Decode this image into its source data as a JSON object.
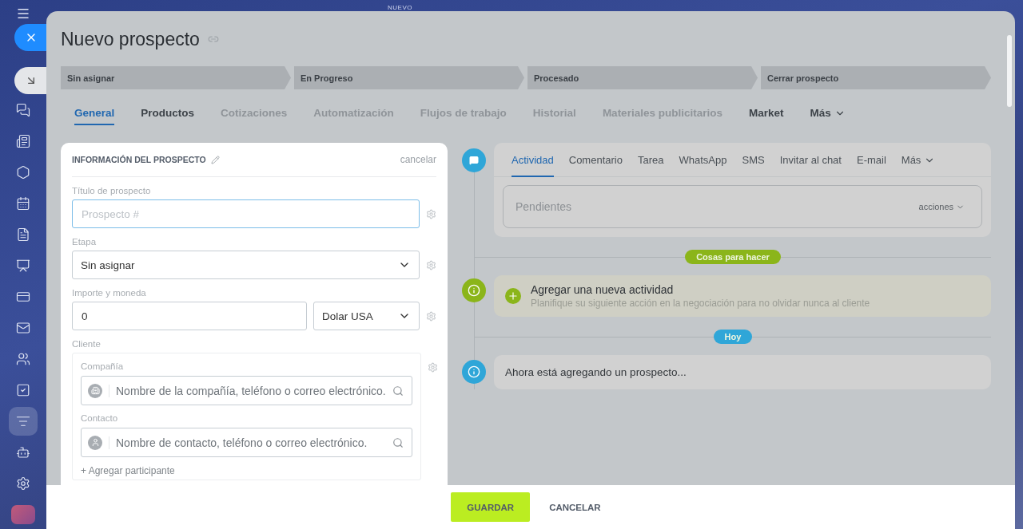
{
  "background_label": "NUEVO",
  "title": "Nuevo prospecto",
  "stages": [
    {
      "label": "Sin asignar"
    },
    {
      "label": "En Progreso"
    },
    {
      "label": "Procesado"
    },
    {
      "label": "Cerrar prospecto"
    }
  ],
  "tabs": [
    {
      "label": "General",
      "selected": true,
      "disabled": false
    },
    {
      "label": "Productos",
      "selected": false,
      "disabled": false
    },
    {
      "label": "Cotizaciones",
      "selected": false,
      "disabled": true
    },
    {
      "label": "Automatización",
      "selected": false,
      "disabled": true
    },
    {
      "label": "Flujos de trabajo",
      "selected": false,
      "disabled": true
    },
    {
      "label": "Historial",
      "selected": false,
      "disabled": true
    },
    {
      "label": "Materiales publicitarios",
      "selected": false,
      "disabled": true
    },
    {
      "label": "Market",
      "selected": false,
      "disabled": false
    },
    {
      "label": "Más",
      "selected": false,
      "disabled": false,
      "dropdown": true
    }
  ],
  "info_card": {
    "title": "INFORMACIÓN DEL PROSPECTO",
    "cancel": "cancelar",
    "title_field": {
      "label": "Título de prospecto",
      "placeholder": "Prospecto #"
    },
    "stage_field": {
      "label": "Etapa",
      "value": "Sin asignar"
    },
    "amount_field": {
      "label": "Importe y moneda",
      "value": "0",
      "currency": "Dolar USA"
    },
    "client": {
      "label": "Cliente",
      "company": {
        "label": "Compañía",
        "placeholder": "Nombre de la compañía, teléfono o correo electrónico."
      },
      "contact": {
        "label": "Contacto",
        "placeholder": "Nombre de contacto, teléfono o correo electrónico."
      },
      "add": "+ Agregar participante"
    }
  },
  "activity_tabs": [
    {
      "label": "Actividad",
      "selected": true
    },
    {
      "label": "Comentario",
      "selected": false
    },
    {
      "label": "Tarea",
      "selected": false
    },
    {
      "label": "WhatsApp",
      "selected": false
    },
    {
      "label": "SMS",
      "selected": false
    },
    {
      "label": "Invitar al chat",
      "selected": false
    },
    {
      "label": "E-mail",
      "selected": false
    },
    {
      "label": "Más",
      "selected": false,
      "dropdown": true
    }
  ],
  "pending": {
    "placeholder": "Pendientes",
    "actions": "acciones"
  },
  "todo_badge": "Cosas para hacer",
  "new_activity": {
    "title": "Agregar una nueva actividad",
    "subtitle": "Planifique su siguiente acción en la negociación para no olvidar nunca al cliente"
  },
  "today_badge": "Hoy",
  "event": "Ahora está agregando un prospecto...",
  "buttons": {
    "save": "GUARDAR",
    "cancel": "CANCELAR"
  }
}
